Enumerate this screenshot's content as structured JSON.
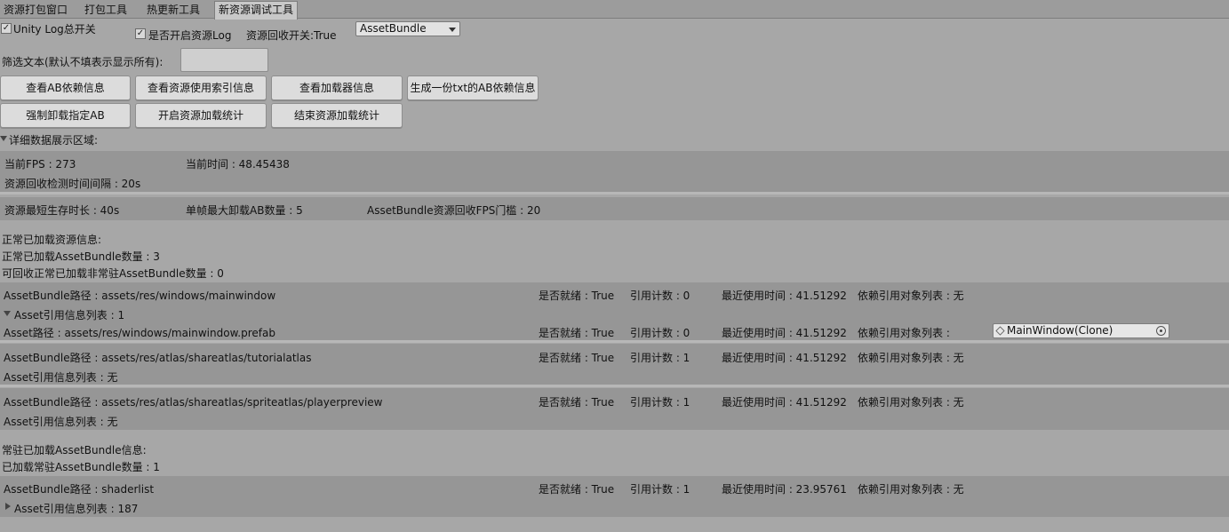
{
  "tabs": [
    {
      "label": "资源打包窗口",
      "active": false
    },
    {
      "label": "打包工具",
      "active": false
    },
    {
      "label": "热更新工具",
      "active": false
    },
    {
      "label": "新资源调试工具",
      "active": true
    }
  ],
  "toolbar": {
    "unity_log_label": "Unity Log总开关",
    "unity_log_checked": true,
    "asset_log_label": "是否开启资源Log",
    "asset_log_checked": true,
    "recycle_switch": "资源回收开关:True",
    "mode_dropdown": "AssetBundle"
  },
  "filter": {
    "label": "筛选文本(默认不填表示显示所有):",
    "value": ""
  },
  "buttons_row1": [
    "查看AB依赖信息",
    "查看资源使用索引信息",
    "查看加载器信息",
    "生成一份txt的AB依赖信息"
  ],
  "buttons_row2": [
    "强制卸载指定AB",
    "开启资源加载统计",
    "结束资源加载统计"
  ],
  "detail_foldout": "详细数据展示区域:",
  "stats": {
    "fps": "当前FPS : 273",
    "current_time": "当前时间 : 48.45438",
    "recycle_interval": "资源回收检测时间间隔 : 20s",
    "min_lifetime": "资源最短生存时长 : 40s",
    "max_unload": "单帧最大卸载AB数量 : 5",
    "fps_threshold": "AssetBundle资源回收FPS门槛 : 20"
  },
  "normal": {
    "header": "正常已加载资源信息:",
    "count": "正常已加载AssetBundle数量 : 3",
    "recyclable": "可回收正常已加载非常驻AssetBundle数量 : 0"
  },
  "normal_bundles": [
    {
      "path": "AssetBundle路径 : assets/res/windows/mainwindow",
      "ready": "是否就绪 : True",
      "ref": "引用计数 : 0",
      "last_used": "最近使用时间 : 41.51292",
      "deps": "依赖引用对象列表 : 无",
      "asset_list": "Asset引用信息列表 : 1",
      "asset": {
        "path": "Asset路径 : assets/res/windows/mainwindow.prefab",
        "ready": "是否就绪 : True",
        "ref": "引用计数 : 0",
        "last_used": "最近使用时间 : 41.51292",
        "deps": "依赖引用对象列表 :",
        "object": "MainWindow(Clone)"
      }
    },
    {
      "path": "AssetBundle路径 : assets/res/atlas/shareatlas/tutorialatlas",
      "ready": "是否就绪 : True",
      "ref": "引用计数 : 1",
      "last_used": "最近使用时间 : 41.51292",
      "deps": "依赖引用对象列表 : 无",
      "asset_list": "Asset引用信息列表 : 无"
    },
    {
      "path": "AssetBundle路径 : assets/res/atlas/shareatlas/spriteatlas/playerpreview",
      "ready": "是否就绪 : True",
      "ref": "引用计数 : 1",
      "last_used": "最近使用时间 : 41.51292",
      "deps": "依赖引用对象列表 : 无",
      "asset_list": "Asset引用信息列表 : 无"
    }
  ],
  "resident": {
    "header": "常驻已加载AssetBundle信息:",
    "count": "已加载常驻AssetBundle数量 : 1"
  },
  "resident_bundles": [
    {
      "path": "AssetBundle路径 : shaderlist",
      "ready": "是否就绪 : True",
      "ref": "引用计数 : 1",
      "last_used": "最近使用时间 : 23.95761",
      "deps": "依赖引用对象列表 : 无",
      "asset_list": "Asset引用信息列表 : 187"
    }
  ]
}
